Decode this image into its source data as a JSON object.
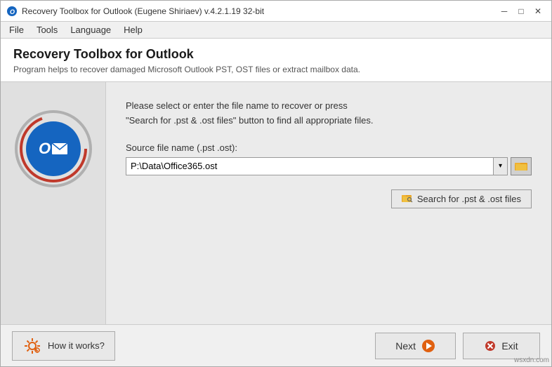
{
  "window": {
    "title": "Recovery Toolbox for Outlook (Eugene Shiriaev) v.4.2.1.19 32-bit",
    "min_label": "─",
    "max_label": "□",
    "close_label": "✕"
  },
  "menu": {
    "items": [
      "File",
      "Tools",
      "Language",
      "Help"
    ]
  },
  "header": {
    "title": "Recovery Toolbox for Outlook",
    "subtitle": "Program helps to recover damaged Microsoft Outlook PST, OST files or extract mailbox data."
  },
  "main": {
    "instruction_line1": "Please select or enter the file name to recover or press",
    "instruction_line2": "\"Search for .pst & .ost files\" button to find all appropriate files.",
    "field_label": "Source file name (.pst .ost):",
    "file_value": "P:\\Data\\Office365.ost",
    "file_placeholder": "P:\\Data\\Office365.ost",
    "search_button": "Search for .pst & .ost files"
  },
  "bottom": {
    "how_it_works": "How it works?",
    "next": "Next",
    "exit": "Exit"
  },
  "watermark": "wsxdn.com"
}
